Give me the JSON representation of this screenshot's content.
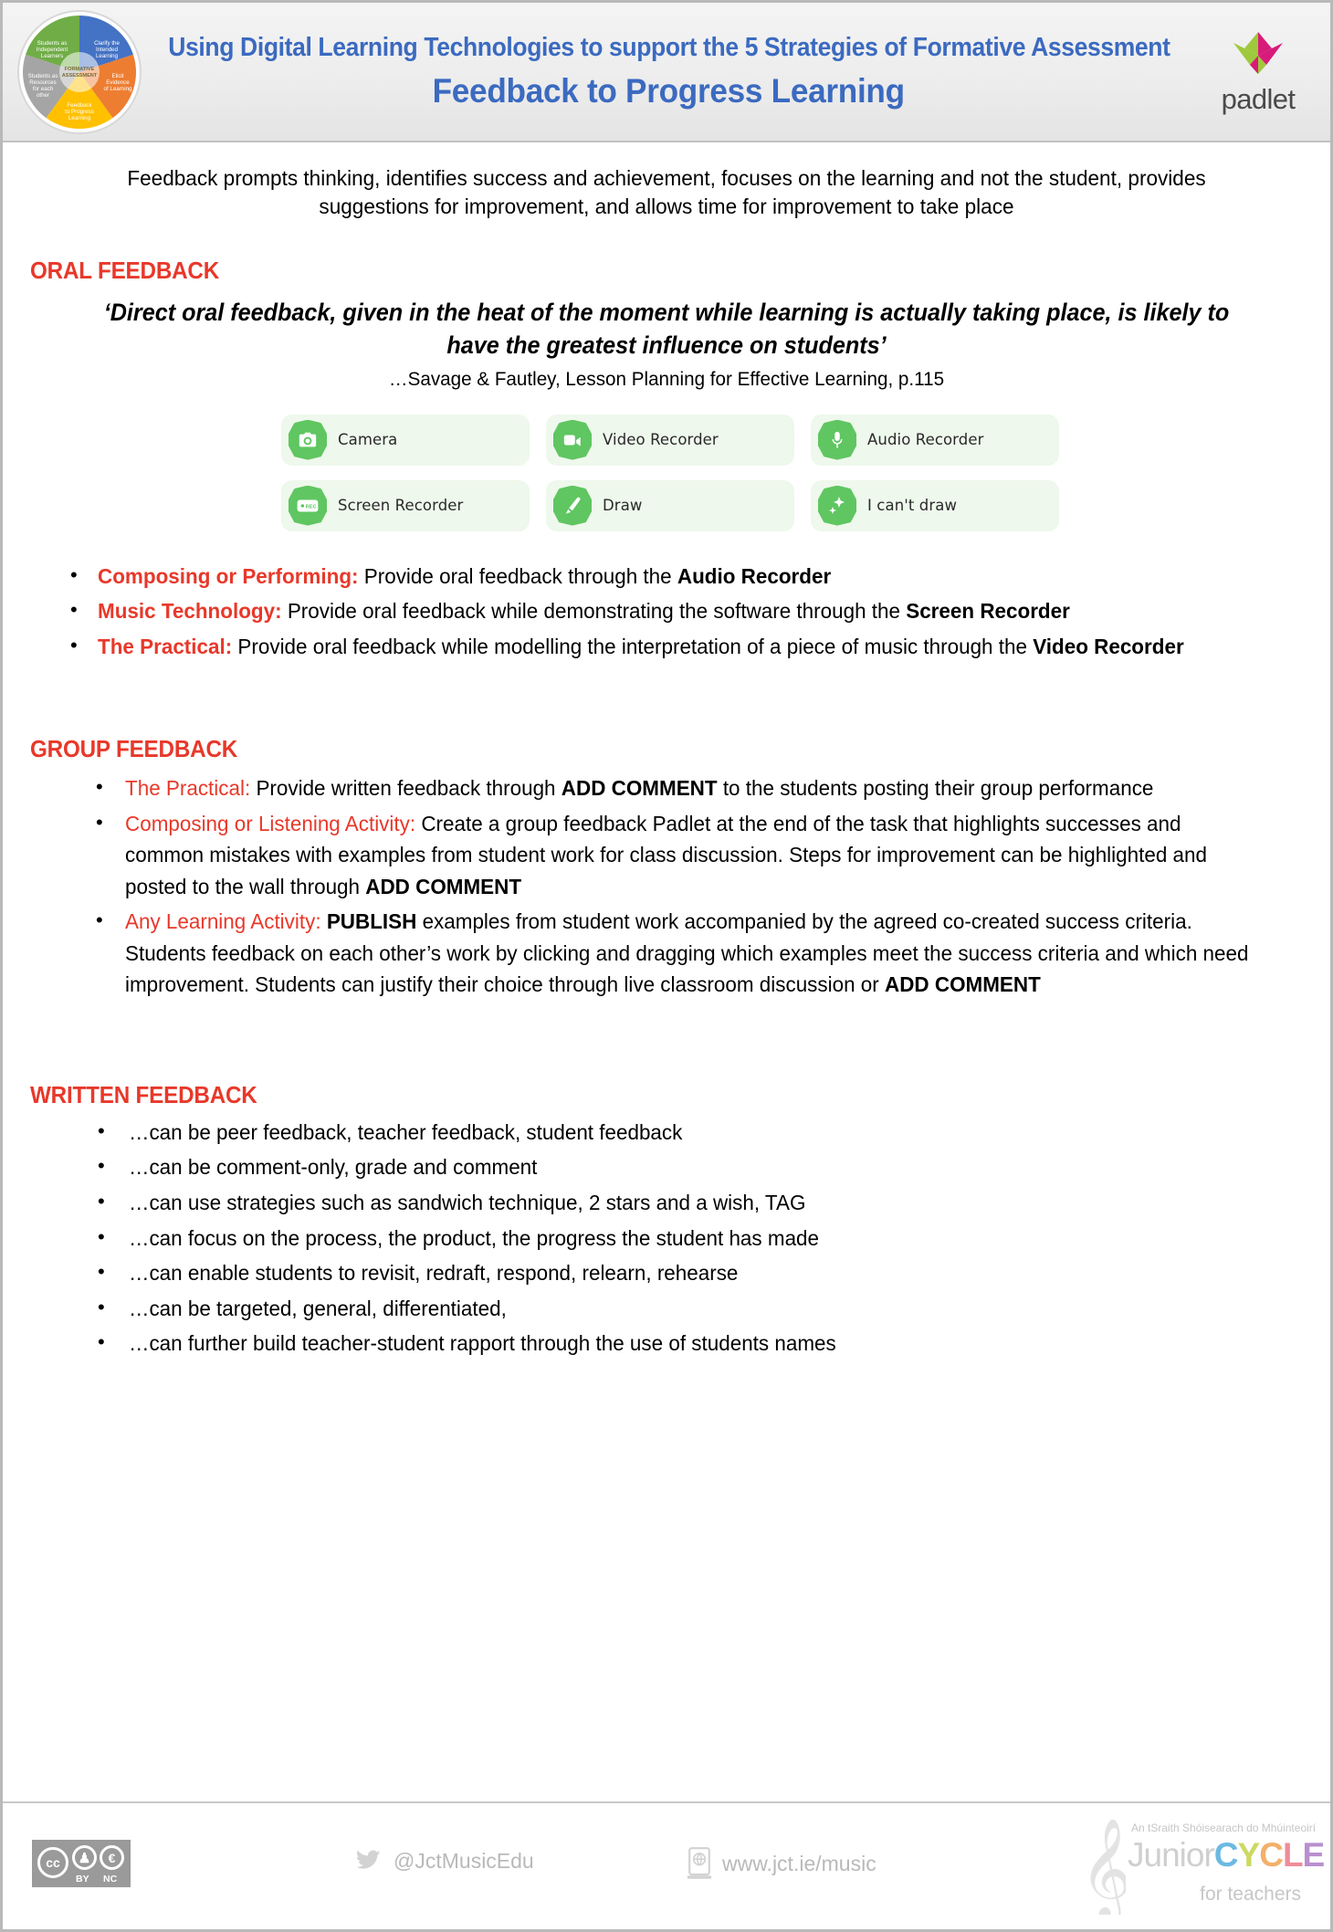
{
  "header": {
    "line1": "Using Digital Learning Technologies to support the 5 Strategies of Formative Assessment",
    "line2": "Feedback to Progress Learning",
    "brand": "padlet",
    "title_color": "#3b6ac0",
    "wheel": {
      "center_label": "FORMATIVE ASSESSMENT",
      "segments": [
        {
          "label": "Clarify the Intended Learning",
          "color": "#4472c4"
        },
        {
          "label": "Elicit Evidence of Learning",
          "color": "#ed7d31"
        },
        {
          "label": "Feedback to Progress Learning",
          "color": "#ffc000"
        },
        {
          "label": "Students as Resources for each other",
          "color": "#a5a5a5"
        },
        {
          "label": "Students as Independent Learners",
          "color": "#70ad47"
        }
      ]
    }
  },
  "intro": "Feedback prompts thinking, identifies success and achievement, focuses on the learning and not the student, provides suggestions for improvement, and allows time for improvement to take place",
  "colors": {
    "heading_red": "#e8382a",
    "chip_bg": "#eef8ec",
    "chip_icon": "#5fc661"
  },
  "oral": {
    "heading": "ORAL FEEDBACK",
    "quote": "‘Direct oral feedback, given in the heat of the moment while learning is actually taking place, is likely to have the greatest influence on students’",
    "quote_source": "…Savage & Fautley, Lesson Planning for Effective Learning, p.115",
    "chips": [
      {
        "label": "Camera",
        "icon": "camera-icon"
      },
      {
        "label": "Video Recorder",
        "icon": "video-camera-icon"
      },
      {
        "label": "Audio Recorder",
        "icon": "microphone-icon"
      },
      {
        "label": "Screen Recorder",
        "icon": "screen-record-icon"
      },
      {
        "label": "Draw",
        "icon": "paintbrush-icon"
      },
      {
        "label": "I can't draw",
        "icon": "sparkles-icon"
      }
    ],
    "bullets": [
      {
        "lead": "Composing or Performing:",
        "text": " Provide oral feedback through the ",
        "bold_tail": "Audio Recorder",
        "tail": ""
      },
      {
        "lead": "Music Technology:",
        "text": " Provide oral feedback while demonstrating the software through the ",
        "bold_tail": "Screen Recorder",
        "tail": ""
      },
      {
        "lead": "The Practical:",
        "text": " Provide oral feedback while modelling the interpretation of a piece of music through the ",
        "bold_tail": "Video Recorder",
        "tail": ""
      }
    ]
  },
  "group": {
    "heading": "GROUP FEEDBACK",
    "bullets": [
      {
        "lead": "The Practical:",
        "a": " Provide written feedback through ",
        "b": "ADD COMMENT",
        "c": " to the students posting their group performance"
      },
      {
        "lead": "Composing or Listening Activity:",
        "a": " Create a group feedback Padlet at the end of the task that highlights successes and common mistakes with examples from student work for class discussion. Steps for improvement can be highlighted and posted to the wall through ",
        "b": "ADD COMMENT",
        "c": ""
      },
      {
        "lead": "Any Learning Activity:",
        "a": " ",
        "b": "PUBLISH",
        "c": " examples from student work accompanied by the agreed co-created success criteria. Students feedback on each other’s work by clicking and dragging which examples meet the success criteria and which need improvement. Students can justify their choice through live classroom discussion or ",
        "d": "ADD COMMENT"
      }
    ]
  },
  "written": {
    "heading": "WRITTEN FEEDBACK",
    "bullets": [
      "…can be peer feedback, teacher feedback, student feedback",
      "…can be comment-only, grade and comment",
      "…can use strategies such as sandwich technique, 2 stars and a wish, TAG",
      "…can focus on the process, the product, the progress the student has made",
      "…can enable students to revisit, redraft, respond, relearn, rehearse",
      "…can be targeted, general, differentiated,",
      "…can further build teacher-student rapport through the use of students names"
    ]
  },
  "footer": {
    "license": {
      "cc": "cc",
      "by": "BY",
      "nc": "NC"
    },
    "twitter_handle": "@JctMusicEdu",
    "website": "www.jct.ie/music",
    "junior_cycle": {
      "tagline_irish": "An tSraith Shóisearach do Mhúinteoirí",
      "word_junior": "Junior",
      "word_cycle": "CYCLE",
      "subtitle": "for teachers",
      "cycle_letter_colors": [
        "#6cb9e2",
        "#cdd95f",
        "#f3b06a",
        "#ef8b9b",
        "#b98fd0"
      ]
    }
  }
}
